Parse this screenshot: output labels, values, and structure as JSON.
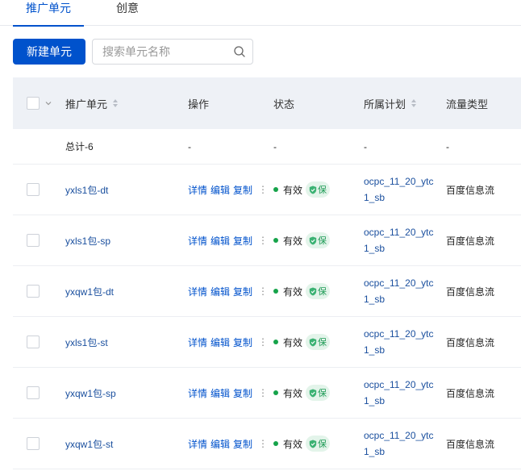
{
  "tabs": [
    {
      "label": "推广单元"
    },
    {
      "label": "创意"
    }
  ],
  "toolbar": {
    "new_button_label": "新建单元",
    "search_placeholder": "搜索单元名称"
  },
  "table": {
    "headers": {
      "name": "推广单元",
      "op": "操作",
      "status": "状态",
      "plan": "所属计划",
      "flow": "流量类型"
    },
    "total": {
      "name": "总计-6",
      "op": "-",
      "status": "-",
      "plan": "-",
      "flow": "-"
    },
    "op_labels": {
      "detail": "详情",
      "edit": "编辑",
      "copy": "复制",
      "more": "⋮"
    },
    "rows": [
      {
        "name": "yxls1包-dt",
        "status": "有效",
        "badge": "保",
        "plan_line1": "ocpc_11_20_ytc",
        "plan_line2": "1_sb",
        "flow": "百度信息流"
      },
      {
        "name": "yxls1包-sp",
        "status": "有效",
        "badge": "保",
        "plan_line1": "ocpc_11_20_ytc",
        "plan_line2": "1_sb",
        "flow": "百度信息流"
      },
      {
        "name": "yxqw1包-dt",
        "status": "有效",
        "badge": "保",
        "plan_line1": "ocpc_11_20_ytc",
        "plan_line2": "1_sb",
        "flow": "百度信息流"
      },
      {
        "name": "yxls1包-st",
        "status": "有效",
        "badge": "保",
        "plan_line1": "ocpc_11_20_ytc",
        "plan_line2": "1_sb",
        "flow": "百度信息流"
      },
      {
        "name": "yxqw1包-sp",
        "status": "有效",
        "badge": "保",
        "plan_line1": "ocpc_11_20_ytc",
        "plan_line2": "1_sb",
        "flow": "百度信息流"
      },
      {
        "name": "yxqw1包-st",
        "status": "有效",
        "badge": "保",
        "plan_line1": "ocpc_11_20_ytc",
        "plan_line2": "1_sb",
        "flow": "百度信息流"
      }
    ]
  },
  "colors": {
    "primary": "#0052cc",
    "status_active": "#16a34a",
    "badge_bg": "#e3f4ea",
    "header_bg": "#eef1f6"
  },
  "icons": {
    "search": "search-icon",
    "sort": "sort-icon",
    "shield": "shield-icon",
    "chevron": "chevron-down-icon",
    "more": "more-vertical-icon"
  }
}
